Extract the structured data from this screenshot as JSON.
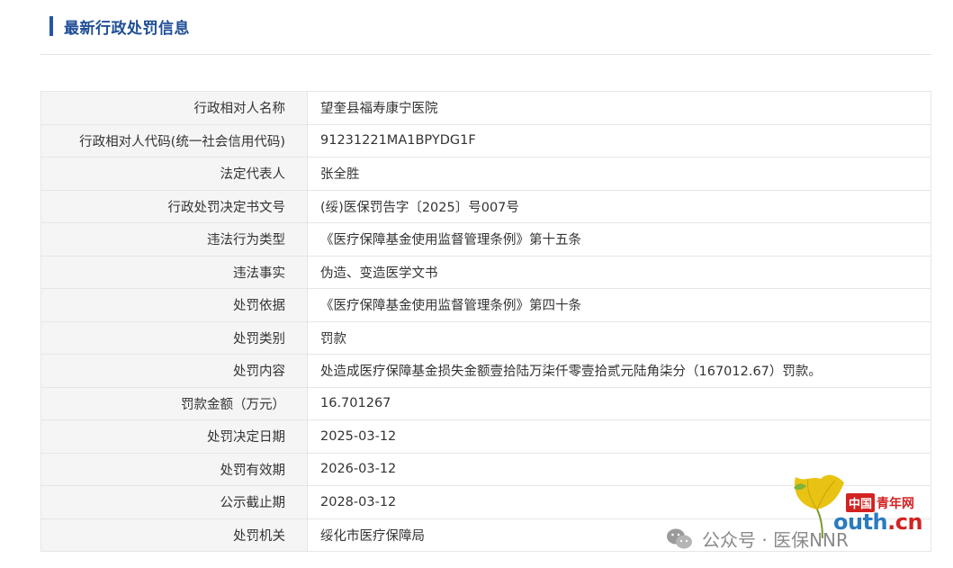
{
  "section": {
    "title": "最新行政处罚信息"
  },
  "table": {
    "rows": [
      {
        "label": "行政相对人名称",
        "value": "望奎县福寿康宁医院"
      },
      {
        "label": "行政相对人代码(统一社会信用代码)",
        "value": "91231221MA1BPYDG1F"
      },
      {
        "label": "法定代表人",
        "value": "张全胜"
      },
      {
        "label": "行政处罚决定书文号",
        "value": "(绥)医保罚告字〔2025〕号007号"
      },
      {
        "label": "违法行为类型",
        "value": "《医疗保障基金使用监督管理条例》第十五条"
      },
      {
        "label": "违法事实",
        "value": "伪造、变造医学文书"
      },
      {
        "label": "处罚依据",
        "value": "《医疗保障基金使用监督管理条例》第四十条"
      },
      {
        "label": "处罚类别",
        "value": "罚款"
      },
      {
        "label": "处罚内容",
        "value": "处造成医疗保障基金损失金额壹拾陆万柒仟零壹拾贰元陆角柒分（167012.67）罚款。"
      },
      {
        "label": "罚款金额（万元）",
        "value": "16.701267"
      },
      {
        "label": "处罚决定日期",
        "value": "2025-03-12"
      },
      {
        "label": "处罚有效期",
        "value": "2026-03-12"
      },
      {
        "label": "公示截止期",
        "value": "2028-03-12"
      },
      {
        "label": "处罚机关",
        "value": "绥化市医疗保障局"
      }
    ]
  },
  "watermark": {
    "text": "公众号 · 医保NNR",
    "icon": "wechat-icon"
  },
  "logo": {
    "top_badge": "中国",
    "top_text": "青年网",
    "url_main": "outh",
    "url_tld": ".cn",
    "icon": "ginkgo-leaf-icon",
    "colors": {
      "red": "#d32222",
      "blue": "#2a7bc0",
      "leaf": "#e8c313"
    }
  },
  "colors": {
    "accent": "#2456a6",
    "label_bg": "#f5f5f5",
    "border": "#e6e6e6"
  }
}
